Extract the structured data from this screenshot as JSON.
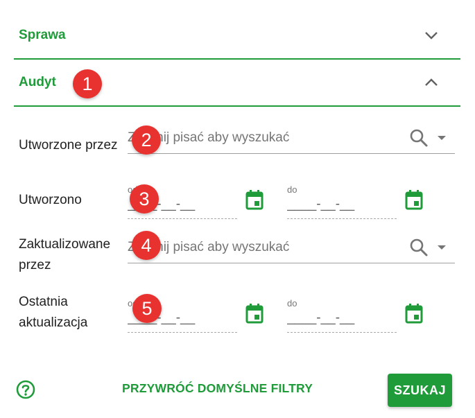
{
  "panels": {
    "sprawa": {
      "title": "Sprawa",
      "expanded": false
    },
    "audyt": {
      "title": "Audyt",
      "expanded": true
    }
  },
  "fields": {
    "created_by": {
      "label": "Utworzone przez",
      "placeholder": "Zacznij pisać aby wyszukać",
      "value": ""
    },
    "created": {
      "label": "Utworzono",
      "from": {
        "label": "od",
        "mask": "____-__-__"
      },
      "to": {
        "label": "do",
        "mask": "____-__-__"
      }
    },
    "updated_by": {
      "label_line1": "Zaktualizowane",
      "label_line2": "przez",
      "placeholder": "Zacznij pisać aby wyszukać",
      "value": ""
    },
    "last_update": {
      "label_line1": "Ostatnia",
      "label_line2": "aktualizacja",
      "from": {
        "label": "od",
        "mask": "____-__-__"
      },
      "to": {
        "label": "do",
        "mask": "____-__-__"
      }
    }
  },
  "badges": [
    "1",
    "2",
    "3",
    "4",
    "5"
  ],
  "footer": {
    "reset_label": "PRZYWRÓĆ DOMYŚLNE FILTRY",
    "search_label": "SZUKAJ"
  },
  "colors": {
    "accent": "#1f9b3a",
    "badge": "#e8322f",
    "icon_gray": "#757575"
  },
  "icons": {
    "sprawa_toggle": "chevron-down-icon",
    "audyt_toggle": "chevron-up-icon",
    "search": "search-icon",
    "dropdown": "arrow-drop-down-icon",
    "calendar": "calendar-icon",
    "help": "help-circle-icon"
  }
}
